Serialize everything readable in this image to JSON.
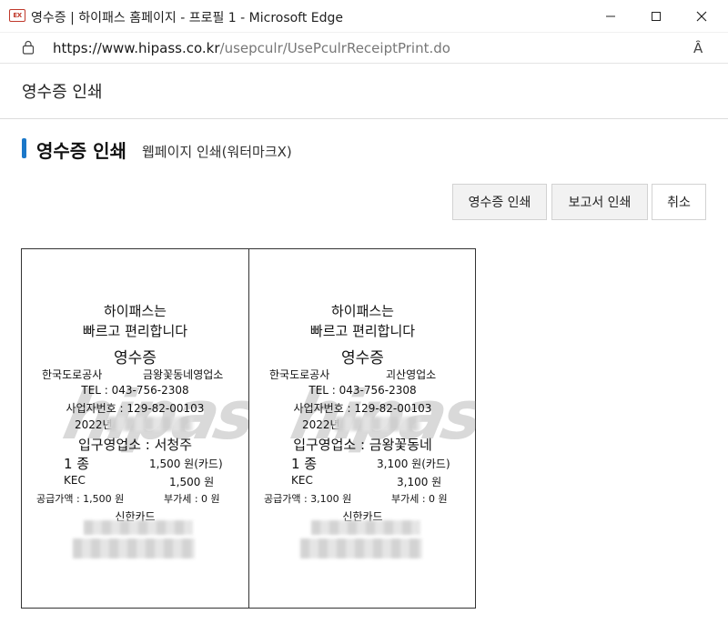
{
  "window": {
    "app_icon_text": "EX",
    "title": "영수증 | 하이패스 홈페이지 - 프로필 1 - Microsoft Edge"
  },
  "address_bar": {
    "url_host": "https://www.hipass.co.kr",
    "url_path": "/usepculr/UsePculrReceiptPrint.do",
    "read_aloud_icon_text": "Ȃ"
  },
  "page": {
    "header_title": "영수증 인쇄",
    "section_title": "영수증 인쇄",
    "section_subtitle": "웹페이지 인쇄(워터마크X)"
  },
  "buttons": {
    "print_receipt": "영수증 인쇄",
    "print_report": "보고서 인쇄",
    "cancel": "취소"
  },
  "receipts": [
    {
      "watermark": "hipass",
      "line1": "하이패스는",
      "line2": "빠르고 편리합니다",
      "heading": "영수증",
      "company": "한국도로공사",
      "office": "금왕꽃동네영업소",
      "tel": "TEL : 043-756-2308",
      "biz_no": "사업자번호 : 129-82-00103",
      "date": "2022년",
      "entry": "입구영업소 : 서청주",
      "class": "1 종",
      "amount": "1,500 원(카드)",
      "kec_label": "KEC",
      "kec_amount": "1,500 원",
      "supply": "공급가액 : 1,500 원",
      "vat": "부가세 : 0 원",
      "card": "신한카드"
    },
    {
      "watermark": "hipass",
      "line1": "하이패스는",
      "line2": "빠르고 편리합니다",
      "heading": "영수증",
      "company": "한국도로공사",
      "office": "괴산영업소",
      "tel": "TEL : 043-756-2308",
      "biz_no": "사업자번호 : 129-82-00103",
      "date": "2022년",
      "entry": "입구영업소 : 금왕꽃동네",
      "class": "1 종",
      "amount": "3,100 원(카드)",
      "kec_label": "KEC",
      "kec_amount": "3,100 원",
      "supply": "공급가액 : 3,100 원",
      "vat": "부가세 : 0 원",
      "card": "신한카드"
    }
  ]
}
